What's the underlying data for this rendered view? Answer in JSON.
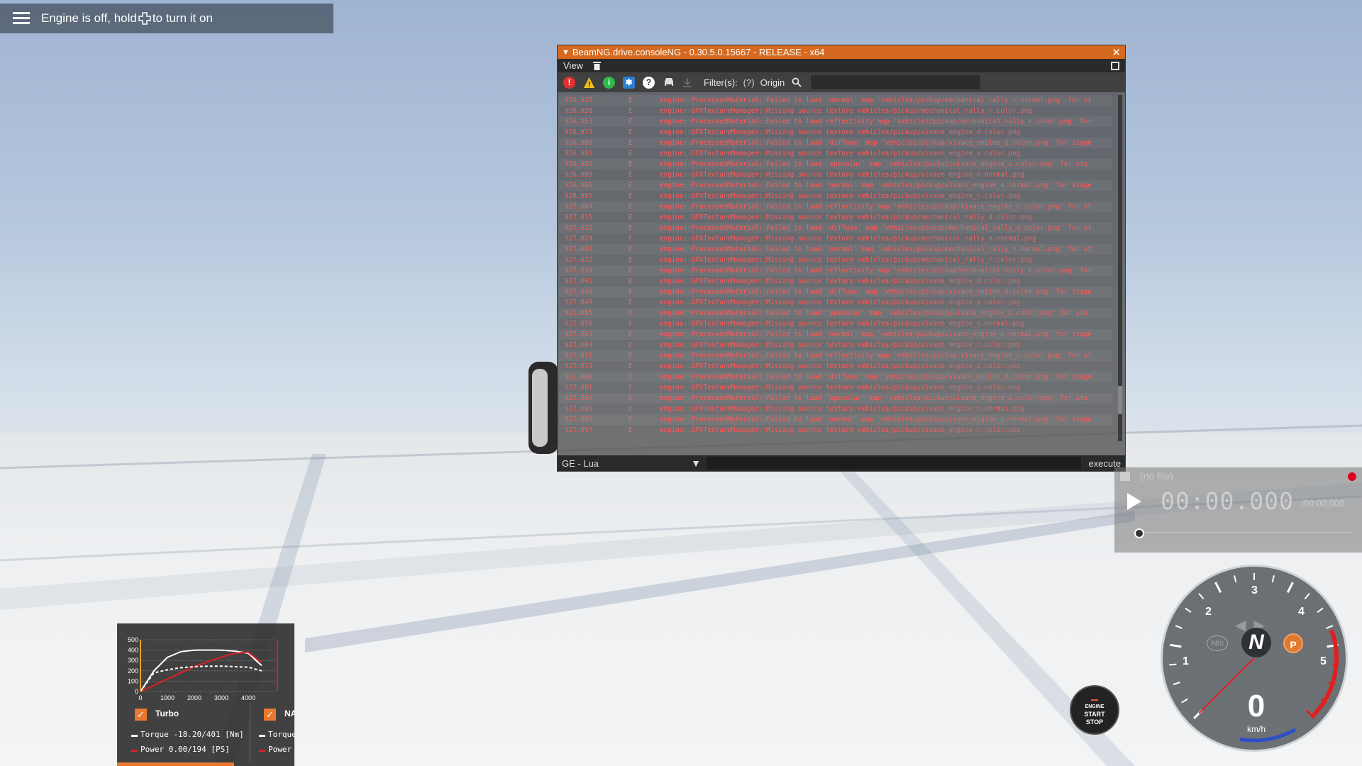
{
  "hud": {
    "hint_prefix": "Engine is off, hold",
    "hint_suffix": "to turn it on"
  },
  "console": {
    "title": "BeamNG.drive.consoleNG - 0.30.5.0.15667 - RELEASE - x64",
    "menu_view": "View",
    "filters_label": "Filter(s):",
    "filters_help": "(?)",
    "origin_label": "Origin",
    "search_placeholder": "",
    "lua_context": "GE - Lua",
    "execute_label": "execute",
    "log_rows": [
      {
        "time": "926.937",
        "level": "E",
        "origin": "engine::ProcessedMaterial::_setSt",
        "msg": "Failed to load 'normal' map 'vehicles/pickup/mechanical_rally_r.normal.png' for st"
      },
      {
        "time": "926.958",
        "level": "E",
        "origin": "engine::GFXTextureManager::_cookT",
        "msg": "Missing source texture vehicles/pickup/mechanical_rally_r.color.png"
      },
      {
        "time": "926.963",
        "level": "E",
        "origin": "engine::ProcessedMaterial::_setSt",
        "msg": "Failed to load reflectivity map 'vehicles/pickup/mechanical_rally_r.color.png' for"
      },
      {
        "time": "926.973",
        "level": "E",
        "origin": "engine::GFXTextureManager::_cookT",
        "msg": "Missing source texture vehicles/pickup/vivace_engine_d.color.png"
      },
      {
        "time": "926.980",
        "level": "E",
        "origin": "engine::ProcessedMaterial::_setSt",
        "msg": "Failed to load 'diffuse' map 'vehicles/pickup/vivace_engine_d.color.png' for stage"
      },
      {
        "time": "926.981",
        "level": "E",
        "origin": "engine::GFXTextureManager::_cookT",
        "msg": "Missing source texture vehicles/pickup/vivace_engine_s.color.png"
      },
      {
        "time": "926.989",
        "level": "E",
        "origin": "engine::ProcessedMaterial::_setSt",
        "msg": "Failed to load 'specular' map 'vehicles/pickup/vivace_engine_s.color.png' for sta"
      },
      {
        "time": "926.989",
        "level": "E",
        "origin": "engine::GFXTextureManager::_cookT",
        "msg": "Missing source texture vehicles/pickup/vivace_engine_n.normal.png"
      },
      {
        "time": "926.996",
        "level": "E",
        "origin": "engine::ProcessedMaterial::_setSt",
        "msg": "Failed to load 'normal' map 'vehicles/pickup/vivace_engine_n.normal.png' for stage"
      },
      {
        "time": "926.997",
        "level": "E",
        "origin": "engine::GFXTextureManager::_cookT",
        "msg": "Missing source texture vehicles/pickup/vivace_engine_r.color.png"
      },
      {
        "time": "927.004",
        "level": "E",
        "origin": "engine::ProcessedMaterial::_setSt",
        "msg": "Failed to load reflectivity map 'vehicles/pickup/vivace_engine_r.color.png' for st"
      },
      {
        "time": "927.015",
        "level": "E",
        "origin": "engine::GFXTextureManager::_cookT",
        "msg": "Missing source texture vehicles/pickup/mechanical_rally_d.color.png"
      },
      {
        "time": "927.022",
        "level": "E",
        "origin": "engine::ProcessedMaterial::_setSt",
        "msg": "Failed to load 'diffuse' map 'vehicles/pickup/mechanical_rally_d.color.png' for st"
      },
      {
        "time": "927.024",
        "level": "E",
        "origin": "engine::GFXTextureManager::_cookT",
        "msg": "Missing source texture vehicles/pickup/mechanical_rally_n.normal.png"
      },
      {
        "time": "927.031",
        "level": "E",
        "origin": "engine::ProcessedMaterial::_setSt",
        "msg": "Failed to load 'normal' map 'vehicles/pickup/mechanical_rally_n.normal.png' for st"
      },
      {
        "time": "927.032",
        "level": "E",
        "origin": "engine::GFXTextureManager::_cookT",
        "msg": "Missing source texture vehicles/pickup/mechanical_rally_r.color.png"
      },
      {
        "time": "927.039",
        "level": "E",
        "origin": "engine::ProcessedMaterial::_setSt",
        "msg": "Failed to load reflectivity map 'vehicles/pickup/mechanical_rally_r.color.png' for"
      },
      {
        "time": "927.041",
        "level": "E",
        "origin": "engine::GFXTextureManager::_cookT",
        "msg": "Missing source texture vehicles/pickup/vivace_engine_d.color.png"
      },
      {
        "time": "927.048",
        "level": "E",
        "origin": "engine::ProcessedMaterial::_setSt",
        "msg": "Failed to load 'diffuse' map 'vehicles/pickup/vivace_engine_d.color.png' for stage"
      },
      {
        "time": "927.049",
        "level": "E",
        "origin": "engine::GFXTextureManager::_cookT",
        "msg": "Missing source texture vehicles/pickup/vivace_engine_s.color.png"
      },
      {
        "time": "927.055",
        "level": "E",
        "origin": "engine::ProcessedMaterial::_setSt",
        "msg": "Failed to load 'specular' map 'vehicles/pickup/vivace_engine_s.color.png' for sta"
      },
      {
        "time": "927.056",
        "level": "E",
        "origin": "engine::GFXTextureManager::_cookT",
        "msg": "Missing source texture vehicles/pickup/vivace_engine_n.normal.png"
      },
      {
        "time": "927.063",
        "level": "E",
        "origin": "engine::ProcessedMaterial::_setSt",
        "msg": "Failed to load 'normal' map 'vehicles/pickup/vivace_engine_n.normal.png' for stage"
      },
      {
        "time": "927.064",
        "level": "E",
        "origin": "engine::GFXTextureManager::_cookT",
        "msg": "Missing source texture vehicles/pickup/vivace_engine_r.color.png"
      },
      {
        "time": "927.071",
        "level": "E",
        "origin": "engine::ProcessedMaterial::_setSt",
        "msg": "Failed to load reflectivity map 'vehicles/pickup/vivace_engine_r.color.png' for st"
      },
      {
        "time": "927.073",
        "level": "E",
        "origin": "engine::GFXTextureManager::_cookT",
        "msg": "Missing source texture vehicles/pickup/vivace_engine_d.color.png"
      },
      {
        "time": "927.080",
        "level": "E",
        "origin": "engine::ProcessedMaterial::_setSt",
        "msg": "Failed to load 'diffuse' map 'vehicles/pickup/vivace_engine_d.color.png' for stage"
      },
      {
        "time": "927.081",
        "level": "E",
        "origin": "engine::GFXTextureManager::_cookT",
        "msg": "Missing source texture vehicles/pickup/vivace_engine_s.color.png"
      },
      {
        "time": "927.088",
        "level": "E",
        "origin": "engine::ProcessedMaterial::_setSt",
        "msg": "Failed to load 'specular' map 'vehicles/pickup/vivace_engine_s.color.png' for sta"
      },
      {
        "time": "927.089",
        "level": "E",
        "origin": "engine::GFXTextureManager::_cookT",
        "msg": "Missing source texture vehicles/pickup/vivace_engine_n.normal.png"
      },
      {
        "time": "927.096",
        "level": "E",
        "origin": "engine::ProcessedMaterial::_setSt",
        "msg": "Failed to load 'normal' map 'vehicles/pickup/vivace_engine_n.normal.png' for stage"
      },
      {
        "time": "927.097",
        "level": "E",
        "origin": "engine::GFXTextureManager::_cookT",
        "msg": "Missing source texture vehicles/pickup/vivace_engine_r.color.png"
      }
    ]
  },
  "replay": {
    "file_label": "(no file)",
    "time": "00:00.000",
    "total": "/00:00.000"
  },
  "engine_button": {
    "line1": "ENGINE",
    "line2": "START",
    "line3": "STOP"
  },
  "gauge": {
    "gear": "N",
    "speed": "0",
    "unit": "km/h",
    "abs_label": "ABS",
    "park_label": "P",
    "rpm_labels": [
      "1",
      "2",
      "3",
      "4",
      "5"
    ]
  },
  "torque_panel": {
    "turbo_label": "Turbo",
    "na_label": "NA",
    "torque_row": "Torque -18.20/401 [Nm]",
    "power_row": "Power  0.00/194  [PS]",
    "na_torque": "Torque",
    "na_power": "Power",
    "check": "✓"
  },
  "chart_data": {
    "type": "line",
    "title": "",
    "xlabel": "",
    "ylabel": "",
    "x_ticks": [
      "0",
      "1000",
      "2000",
      "3000",
      "4000"
    ],
    "y_ticks": [
      "0",
      "100",
      "200",
      "300",
      "400",
      "500"
    ],
    "xlim": [
      0,
      5000
    ],
    "ylim": [
      0,
      500
    ],
    "x": [
      0,
      500,
      1000,
      1500,
      2000,
      2500,
      3000,
      3500,
      4000,
      4500
    ],
    "series": [
      {
        "values": [
          0,
          200,
          330,
          385,
          400,
          401,
          400,
          390,
          370,
          250
        ]
      },
      {
        "values": [
          0,
          60,
          120,
          180,
          240,
          290,
          330,
          370,
          380,
          280
        ]
      },
      {
        "values": [
          0,
          180,
          210,
          230,
          240,
          245,
          245,
          240,
          235,
          200
        ]
      }
    ],
    "colors": [
      "#ffffff",
      "#e02020",
      "#ffffff"
    ]
  }
}
